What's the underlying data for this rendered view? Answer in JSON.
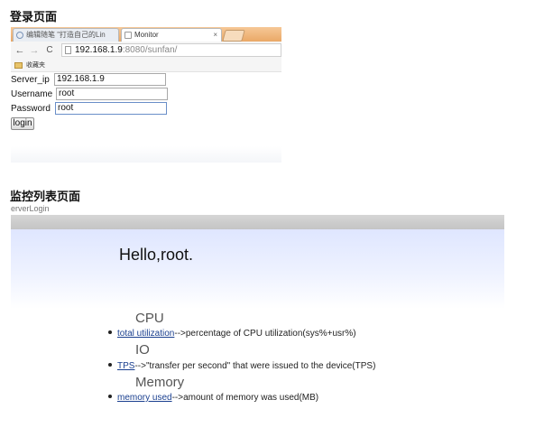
{
  "sections": {
    "login_title": "登录页面",
    "monitor_title": "监控列表页面"
  },
  "browser": {
    "tabs": [
      {
        "label": "编辑随笔 \"打造自己的Lin",
        "icon": "site-favicon-icon"
      },
      {
        "label": "Monitor",
        "icon": "page-icon"
      }
    ],
    "tab_close_glyph": "×",
    "address": {
      "host": "192.168.1.9",
      "path": ":8080/sunfan/"
    },
    "nav": {
      "back": "←",
      "forward": "→",
      "reload": "C"
    },
    "bookmarks_folder": "收藏夹"
  },
  "login_form": {
    "fields": [
      {
        "label": "Server_ip",
        "value": "192.168.1.9"
      },
      {
        "label": "Username",
        "value": "root"
      },
      {
        "label": "Password",
        "value": "root"
      }
    ],
    "submit_label": "login"
  },
  "monitor": {
    "crumb": "erverLogin",
    "greeting": "Hello,root.",
    "groups": [
      {
        "title": "CPU",
        "link": "total utilization",
        "desc": "-->percentage of CPU utilization(sys%+usr%)"
      },
      {
        "title": "IO",
        "link": "TPS",
        "desc": "-->\"transfer per second\" that were issued to the device(TPS)"
      },
      {
        "title": "Memory",
        "link": "memory used",
        "desc": "-->amount of memory was used(MB)"
      }
    ]
  },
  "colors": {
    "tabstrip": "#eaa866",
    "link": "#1a3f8f",
    "hero_gradient_top": "#dfe6ff"
  }
}
